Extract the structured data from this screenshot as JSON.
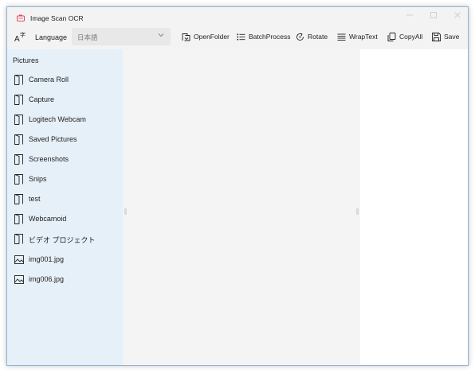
{
  "window": {
    "title": "Image Scan OCR"
  },
  "toolbar": {
    "language_label": "Language",
    "language_value": "日本語",
    "buttons": [
      {
        "label": "OpenFolder",
        "icon": "folder-open-icon"
      },
      {
        "label": "BatchProcess",
        "icon": "list-icon"
      },
      {
        "label": "Rotate",
        "icon": "rotate-icon"
      },
      {
        "label": "WrapText",
        "icon": "wrap-text-icon"
      },
      {
        "label": "CopyAll",
        "icon": "copy-icon"
      },
      {
        "label": "Save",
        "icon": "save-icon"
      }
    ]
  },
  "sidebar": {
    "header": "Pictures",
    "items": [
      {
        "label": "Camera Roll",
        "icon": "folder-icon"
      },
      {
        "label": "Capture",
        "icon": "folder-icon"
      },
      {
        "label": "Logitech Webcam",
        "icon": "folder-icon"
      },
      {
        "label": "Saved Pictures",
        "icon": "folder-icon"
      },
      {
        "label": "Screenshots",
        "icon": "folder-icon"
      },
      {
        "label": "Snips",
        "icon": "folder-icon"
      },
      {
        "label": "test",
        "icon": "folder-icon"
      },
      {
        "label": "Webcamoid",
        "icon": "folder-icon"
      },
      {
        "label": "ビデオ プロジェクト",
        "icon": "folder-icon"
      },
      {
        "label": "img001.jpg",
        "icon": "image-icon"
      },
      {
        "label": "img006.jpg",
        "icon": "image-icon"
      }
    ]
  },
  "colors": {
    "sidebar_bg": "#e6f0f8",
    "center_bg": "#f4f4f4",
    "right_bg": "#ffffff",
    "app_icon": "#e04a5f"
  }
}
